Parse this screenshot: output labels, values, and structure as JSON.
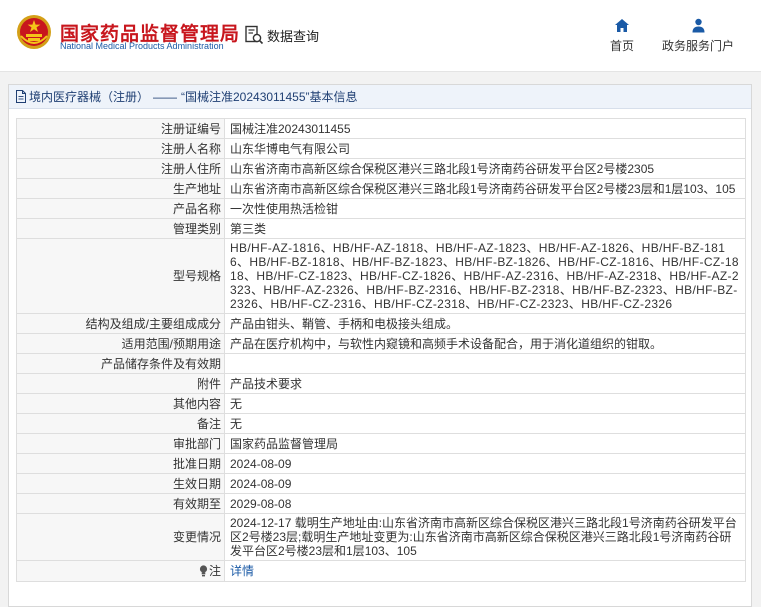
{
  "header": {
    "org_name_cn": "国家药品监督管理局",
    "org_name_en": "National Medical Products Administration",
    "search_link": "数据查询",
    "nav": {
      "home": "首页",
      "gov_portal": "政务服务门户"
    }
  },
  "breadcrumb": {
    "category": "境内医疗器械（注册）",
    "separator": "——",
    "record_title": "“国械注准20243011455”基本信息"
  },
  "record": {
    "registration_no": {
      "label": "注册证编号",
      "value": "国械注准20243011455"
    },
    "registrant": {
      "label": "注册人名称",
      "value": "山东华博电气有限公司"
    },
    "registrant_address": {
      "label": "注册人住所",
      "value": "山东省济南市高新区综合保税区港兴三路北段1号济南药谷研发平台区2号楼2305"
    },
    "production_address": {
      "label": "生产地址",
      "value": "山东省济南市高新区综合保税区港兴三路北段1号济南药谷研发平台区2号楼23层和1层103、105"
    },
    "product_name": {
      "label": "产品名称",
      "value": "一次性使用热活检钳"
    },
    "management_class": {
      "label": "管理类别",
      "value": "第三类"
    },
    "models": {
      "label": "型号规格",
      "value": "HB/HF-AZ-1816、HB/HF-AZ-1818、HB/HF-AZ-1823、HB/HF-AZ-1826、HB/HF-BZ-1816、HB/HF-BZ-1818、HB/HF-BZ-1823、HB/HF-BZ-1826、HB/HF-CZ-1816、HB/HF-CZ-1818、HB/HF-CZ-1823、HB/HF-CZ-1826、HB/HF-AZ-2316、HB/HF-AZ-2318、HB/HF-AZ-2323、HB/HF-AZ-2326、HB/HF-BZ-2316、HB/HF-BZ-2318、HB/HF-BZ-2323、HB/HF-BZ-2326、HB/HF-CZ-2316、HB/HF-CZ-2318、HB/HF-CZ-2323、HB/HF-CZ-2326"
    },
    "composition": {
      "label": "结构及组成/主要组成成分",
      "value": "产品由钳头、鞘管、手柄和电极接头组成。"
    },
    "intended_use": {
      "label": "适用范围/预期用途",
      "value": "产品在医疗机构中，与软性内窥镜和高频手术设备配合，用于消化道组织的钳取。"
    },
    "storage": {
      "label": "产品储存条件及有效期",
      "value": ""
    },
    "attachment": {
      "label": "附件",
      "value": "产品技术要求"
    },
    "other_content": {
      "label": "其他内容",
      "value": "无"
    },
    "remarks": {
      "label": "备注",
      "value": "无"
    },
    "approval_dept": {
      "label": "审批部门",
      "value": "国家药品监督管理局"
    },
    "approval_date": {
      "label": "批准日期",
      "value": "2024-08-09"
    },
    "effective_date": {
      "label": "生效日期",
      "value": "2024-08-09"
    },
    "expiry_date": {
      "label": "有效期至",
      "value": "2029-08-08"
    },
    "change_info": {
      "label": "变更情况",
      "value": "2024-12-17 载明生产地址由:山东省济南市高新区综合保税区港兴三路北段1号济南药谷研发平台区2号楼23层;载明生产地址变更为:山东省济南市高新区综合保税区港兴三路北段1号济南药谷研发平台区2号楼23层和1层103、105"
    },
    "note": {
      "label": "注",
      "link_text": "详情"
    }
  },
  "colors": {
    "brand_red": "#c8161d",
    "brand_blue": "#1a5aa6",
    "crumb_text": "#1f3f73"
  },
  "icons": {
    "emblem": "national-emblem-icon",
    "search": "search-doc-icon",
    "home": "home-icon",
    "gov": "user-icon",
    "crumb": "document-icon",
    "note": "lightbulb-icon"
  }
}
